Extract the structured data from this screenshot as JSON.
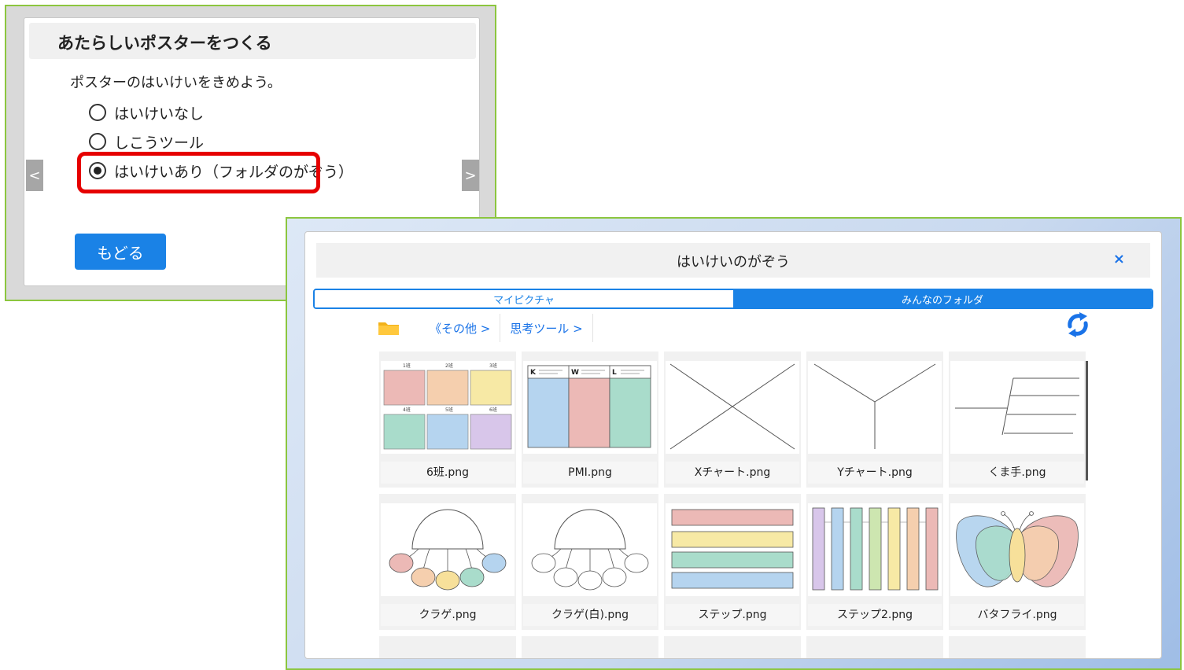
{
  "new_poster_dialog": {
    "title": "あたらしいポスターをつくる",
    "question": "ポスターのはいけいをきめよう。",
    "options": [
      {
        "label": "はいけいなし",
        "selected": false
      },
      {
        "label": "しこうツール",
        "selected": false
      },
      {
        "label": "はいけいあり（フォルダのがぞう）",
        "selected": true
      }
    ],
    "prev_glyph": "<",
    "next_glyph": ">",
    "back_label": "もどる"
  },
  "image_dialog": {
    "title": "はいけいのがぞう",
    "close_glyph": "×",
    "tabs": [
      {
        "label": "マイピクチャ",
        "active": false
      },
      {
        "label": "みんなのフォルダ",
        "active": true
      }
    ],
    "breadcrumb": [
      "《その他 >",
      "思考ツール >"
    ],
    "images": [
      {
        "name": "6班.png",
        "icon": "grid-6-thumbnail"
      },
      {
        "name": "PMI.png",
        "icon": "kwl-chart-thumbnail"
      },
      {
        "name": "Xチャート.png",
        "icon": "x-chart-thumbnail"
      },
      {
        "name": "Yチャート.png",
        "icon": "y-chart-thumbnail"
      },
      {
        "name": "くま手.png",
        "icon": "rake-chart-thumbnail"
      },
      {
        "name": "クラゲ.png",
        "icon": "jellyfish-color-thumbnail"
      },
      {
        "name": "クラゲ(白).png",
        "icon": "jellyfish-white-thumbnail"
      },
      {
        "name": "ステップ.png",
        "icon": "steps-thumbnail"
      },
      {
        "name": "ステップ2.png",
        "icon": "steps2-thumbnail"
      },
      {
        "name": "バタフライ.png",
        "icon": "butterfly-thumbnail"
      }
    ]
  },
  "colors": {
    "accent": "#1a82e6",
    "highlight": "#e60000",
    "frame": "#8cc63f"
  }
}
